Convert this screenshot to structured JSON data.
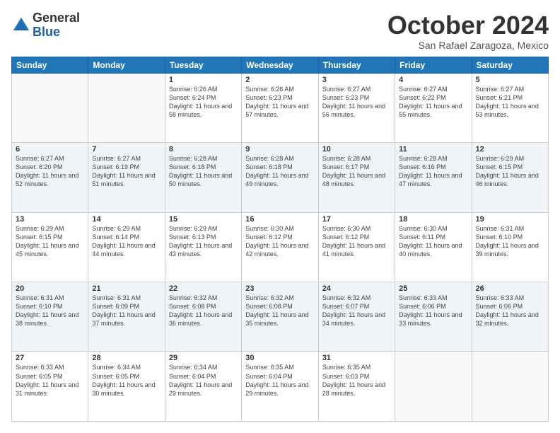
{
  "header": {
    "logo_line1": "General",
    "logo_line2": "Blue",
    "month": "October 2024",
    "location": "San Rafael Zaragoza, Mexico"
  },
  "days_of_week": [
    "Sunday",
    "Monday",
    "Tuesday",
    "Wednesday",
    "Thursday",
    "Friday",
    "Saturday"
  ],
  "weeks": [
    [
      {
        "day": "",
        "info": ""
      },
      {
        "day": "",
        "info": ""
      },
      {
        "day": "1",
        "info": "Sunrise: 6:26 AM\nSunset: 6:24 PM\nDaylight: 11 hours and 58 minutes."
      },
      {
        "day": "2",
        "info": "Sunrise: 6:26 AM\nSunset: 6:23 PM\nDaylight: 11 hours and 57 minutes."
      },
      {
        "day": "3",
        "info": "Sunrise: 6:27 AM\nSunset: 6:23 PM\nDaylight: 11 hours and 56 minutes."
      },
      {
        "day": "4",
        "info": "Sunrise: 6:27 AM\nSunset: 6:22 PM\nDaylight: 11 hours and 55 minutes."
      },
      {
        "day": "5",
        "info": "Sunrise: 6:27 AM\nSunset: 6:21 PM\nDaylight: 11 hours and 53 minutes."
      }
    ],
    [
      {
        "day": "6",
        "info": "Sunrise: 6:27 AM\nSunset: 6:20 PM\nDaylight: 11 hours and 52 minutes."
      },
      {
        "day": "7",
        "info": "Sunrise: 6:27 AM\nSunset: 6:19 PM\nDaylight: 11 hours and 51 minutes."
      },
      {
        "day": "8",
        "info": "Sunrise: 6:28 AM\nSunset: 6:18 PM\nDaylight: 11 hours and 50 minutes."
      },
      {
        "day": "9",
        "info": "Sunrise: 6:28 AM\nSunset: 6:18 PM\nDaylight: 11 hours and 49 minutes."
      },
      {
        "day": "10",
        "info": "Sunrise: 6:28 AM\nSunset: 6:17 PM\nDaylight: 11 hours and 48 minutes."
      },
      {
        "day": "11",
        "info": "Sunrise: 6:28 AM\nSunset: 6:16 PM\nDaylight: 11 hours and 47 minutes."
      },
      {
        "day": "12",
        "info": "Sunrise: 6:29 AM\nSunset: 6:15 PM\nDaylight: 11 hours and 46 minutes."
      }
    ],
    [
      {
        "day": "13",
        "info": "Sunrise: 6:29 AM\nSunset: 6:15 PM\nDaylight: 11 hours and 45 minutes."
      },
      {
        "day": "14",
        "info": "Sunrise: 6:29 AM\nSunset: 6:14 PM\nDaylight: 11 hours and 44 minutes."
      },
      {
        "day": "15",
        "info": "Sunrise: 6:29 AM\nSunset: 6:13 PM\nDaylight: 11 hours and 43 minutes."
      },
      {
        "day": "16",
        "info": "Sunrise: 6:30 AM\nSunset: 6:12 PM\nDaylight: 11 hours and 42 minutes."
      },
      {
        "day": "17",
        "info": "Sunrise: 6:30 AM\nSunset: 6:12 PM\nDaylight: 11 hours and 41 minutes."
      },
      {
        "day": "18",
        "info": "Sunrise: 6:30 AM\nSunset: 6:11 PM\nDaylight: 11 hours and 40 minutes."
      },
      {
        "day": "19",
        "info": "Sunrise: 6:31 AM\nSunset: 6:10 PM\nDaylight: 11 hours and 39 minutes."
      }
    ],
    [
      {
        "day": "20",
        "info": "Sunrise: 6:31 AM\nSunset: 6:10 PM\nDaylight: 11 hours and 38 minutes."
      },
      {
        "day": "21",
        "info": "Sunrise: 6:31 AM\nSunset: 6:09 PM\nDaylight: 11 hours and 37 minutes."
      },
      {
        "day": "22",
        "info": "Sunrise: 6:32 AM\nSunset: 6:08 PM\nDaylight: 11 hours and 36 minutes."
      },
      {
        "day": "23",
        "info": "Sunrise: 6:32 AM\nSunset: 6:08 PM\nDaylight: 11 hours and 35 minutes."
      },
      {
        "day": "24",
        "info": "Sunrise: 6:32 AM\nSunset: 6:07 PM\nDaylight: 11 hours and 34 minutes."
      },
      {
        "day": "25",
        "info": "Sunrise: 6:33 AM\nSunset: 6:06 PM\nDaylight: 11 hours and 33 minutes."
      },
      {
        "day": "26",
        "info": "Sunrise: 6:33 AM\nSunset: 6:06 PM\nDaylight: 11 hours and 32 minutes."
      }
    ],
    [
      {
        "day": "27",
        "info": "Sunrise: 6:33 AM\nSunset: 6:05 PM\nDaylight: 11 hours and 31 minutes."
      },
      {
        "day": "28",
        "info": "Sunrise: 6:34 AM\nSunset: 6:05 PM\nDaylight: 11 hours and 30 minutes."
      },
      {
        "day": "29",
        "info": "Sunrise: 6:34 AM\nSunset: 6:04 PM\nDaylight: 11 hours and 29 minutes."
      },
      {
        "day": "30",
        "info": "Sunrise: 6:35 AM\nSunset: 6:04 PM\nDaylight: 11 hours and 29 minutes."
      },
      {
        "day": "31",
        "info": "Sunrise: 6:35 AM\nSunset: 6:03 PM\nDaylight: 11 hours and 28 minutes."
      },
      {
        "day": "",
        "info": ""
      },
      {
        "day": "",
        "info": ""
      }
    ]
  ]
}
